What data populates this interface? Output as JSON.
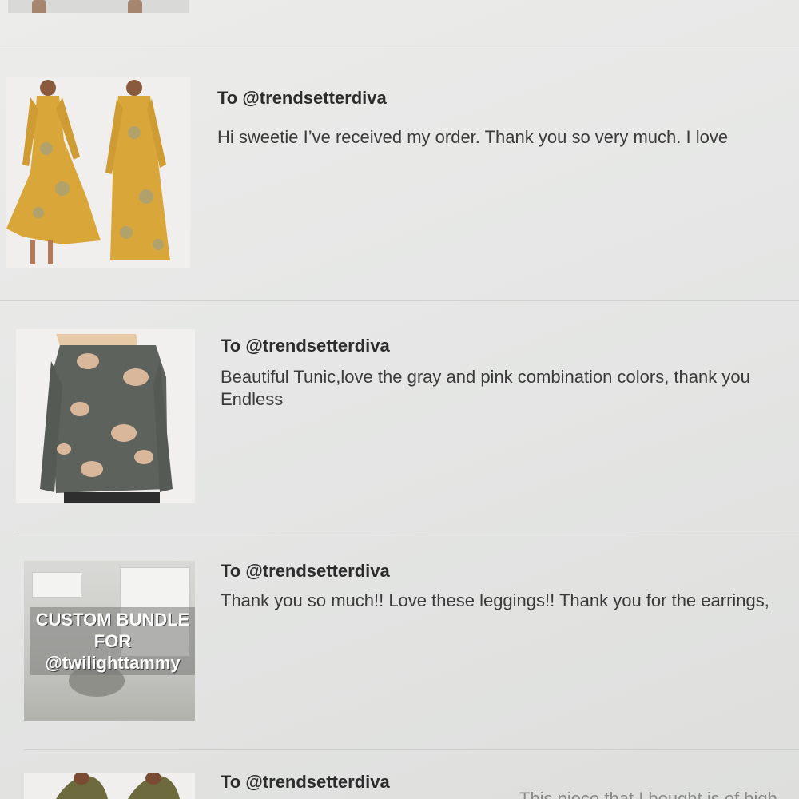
{
  "reviews": [
    {
      "recipient": "To @trendsetterdiva",
      "message": "Hi sweetie I’ve received my order. Thank you so very much. I love"
    },
    {
      "recipient": "To @trendsetterdiva",
      "message": "Beautiful Tunic,love the gray and pink combination colors, thank you\nEndless"
    },
    {
      "recipient": "To @trendsetterdiva",
      "message": "Thank you so much!! Love these leggings!! Thank you for the earrings,",
      "thumb_text": [
        "CUSTOM BUNDLE",
        "FOR",
        "@twilighttammy"
      ]
    },
    {
      "recipient": "To @trendsetterdiva",
      "message": "This piece that I bought is of high qu"
    }
  ],
  "colors": {
    "dress_yellow": "#d9a63a",
    "tunic_gray": "#5e625c",
    "floral_pink": "#d9b79a"
  }
}
